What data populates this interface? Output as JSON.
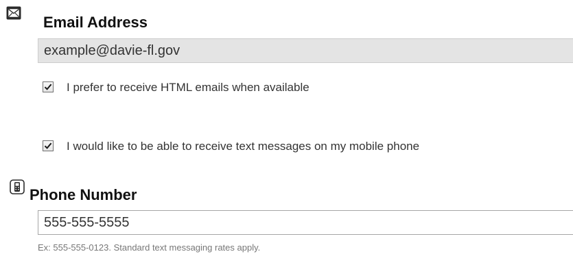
{
  "email_section": {
    "icon": "envelope-icon",
    "title": "Email Address",
    "value": "example@davie-fl.gov"
  },
  "options": {
    "html_email": {
      "checked": true,
      "label": "I prefer to receive HTML emails when available"
    },
    "text_messages": {
      "checked": true,
      "label": "I would like to be able to receive text messages on my mobile phone"
    }
  },
  "phone_section": {
    "icon": "mobile-phone-icon",
    "title": "Phone Number",
    "value": "555-555-5555",
    "hint": "Ex: 555-555-0123. Standard text messaging rates apply."
  }
}
